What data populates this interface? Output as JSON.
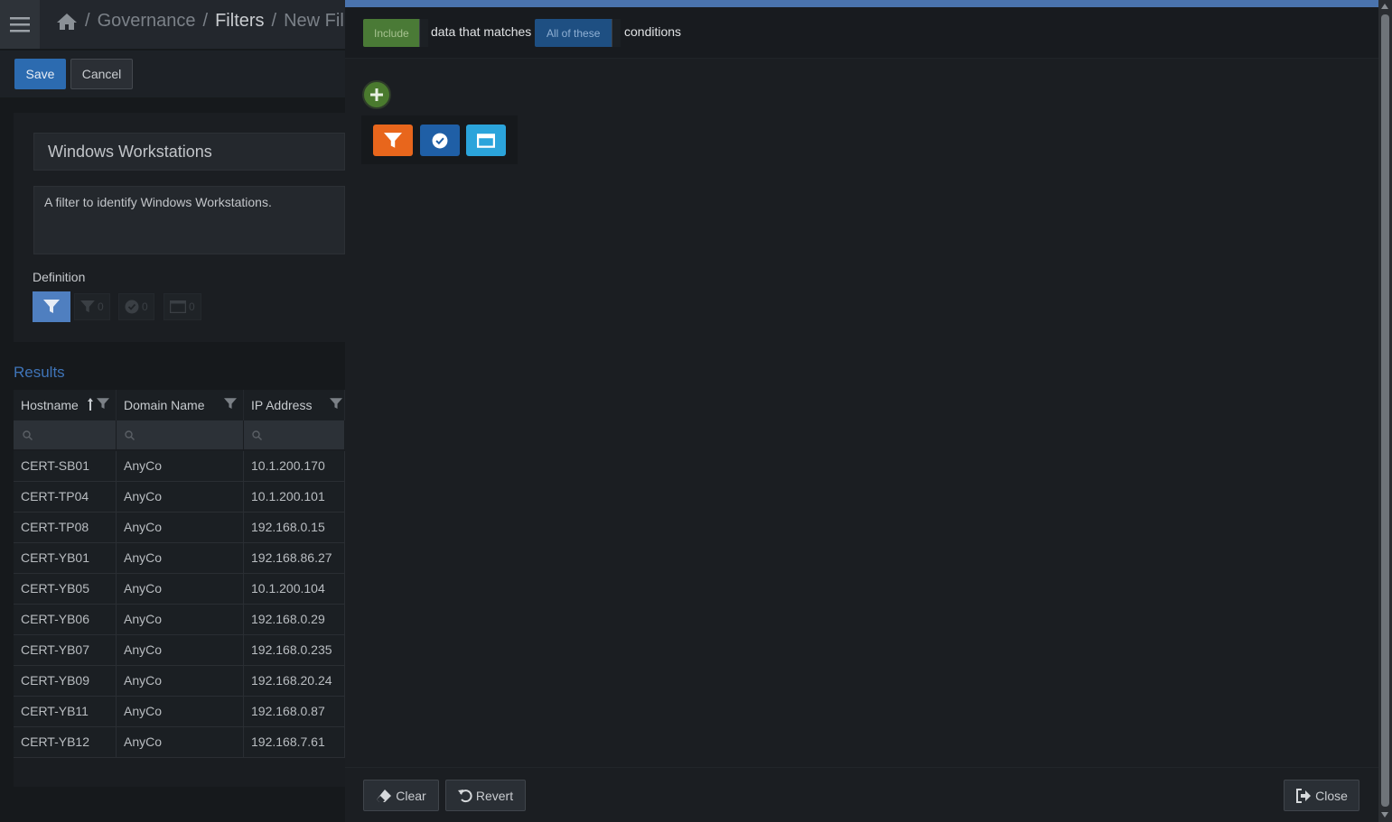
{
  "breadcrumb": {
    "items": [
      "Governance",
      "Filters",
      "New Fil"
    ]
  },
  "toolbar": {
    "save_label": "Save",
    "cancel_label": "Cancel"
  },
  "form": {
    "name_value": "Windows Workstations",
    "description_value": "A filter to identify Windows Workstations.",
    "definition_label": "Definition",
    "counts": {
      "filter": "0",
      "check": "0",
      "window": "0"
    }
  },
  "results": {
    "title": "Results",
    "columns": [
      "Hostname",
      "Domain Name",
      "IP Address"
    ],
    "rows": [
      [
        "CERT-SB01",
        "AnyCo",
        "10.1.200.170"
      ],
      [
        "CERT-TP04",
        "AnyCo",
        "10.1.200.101"
      ],
      [
        "CERT-TP08",
        "AnyCo",
        "192.168.0.15"
      ],
      [
        "CERT-YB01",
        "AnyCo",
        "192.168.86.27"
      ],
      [
        "CERT-YB05",
        "AnyCo",
        "10.1.200.104"
      ],
      [
        "CERT-YB06",
        "AnyCo",
        "192.168.0.29"
      ],
      [
        "CERT-YB07",
        "AnyCo",
        "192.168.0.235"
      ],
      [
        "CERT-YB09",
        "AnyCo",
        "192.168.20.24"
      ],
      [
        "CERT-YB11",
        "AnyCo",
        "192.168.0.87"
      ],
      [
        "CERT-YB12",
        "AnyCo",
        "192.168.7.61"
      ]
    ]
  },
  "conditions": {
    "include_label": "Include",
    "text_middle": "data that matches",
    "match_label": "All of these",
    "text_end": "conditions"
  },
  "footer": {
    "clear_label": "Clear",
    "revert_label": "Revert",
    "close_label": "Close"
  },
  "colors": {
    "accent_blue": "#4a73ad",
    "save_blue": "#2c6bb0",
    "include_green": "#4a7a36",
    "filter_orange": "#e8661c",
    "check_blue": "#1f5fa6",
    "window_cyan": "#2ba4db"
  },
  "icons": [
    "menu-icon",
    "home-icon",
    "filter-icon",
    "check-circle-icon",
    "window-icon",
    "plus-icon",
    "eraser-icon",
    "undo-icon",
    "sign-out-icon",
    "search-icon",
    "sort-asc-icon"
  ]
}
